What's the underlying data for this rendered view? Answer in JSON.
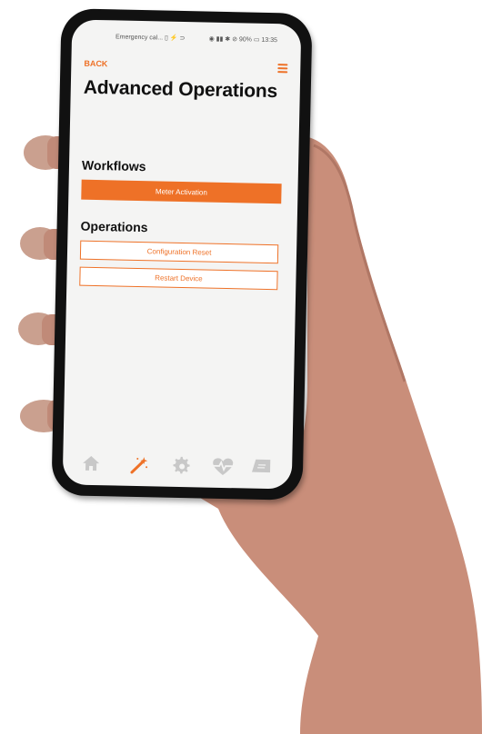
{
  "status_bar": {
    "left_text": "Emergency cal... ▯ ⚡ ⊃",
    "right_text": "◉ ▮▮ ✱ ⊘ 90% ▭ 13:35"
  },
  "header": {
    "back_label": "BACK",
    "title": "Advanced Operations"
  },
  "workflows": {
    "title": "Workflows",
    "buttons": [
      "Meter Activation"
    ]
  },
  "operations": {
    "title": "Operations",
    "buttons": [
      "Configuration Reset",
      "Restart Device"
    ]
  },
  "nav": {
    "items": [
      {
        "icon": "home-icon",
        "active": false
      },
      {
        "icon": "magic-wand-icon",
        "active": true
      },
      {
        "icon": "gear-icon",
        "active": false
      },
      {
        "icon": "heartbeat-icon",
        "active": false
      },
      {
        "icon": "tag-icon",
        "active": false
      }
    ]
  },
  "colors": {
    "accent": "#ee7127",
    "nav_inactive": "#c8c8c8"
  }
}
